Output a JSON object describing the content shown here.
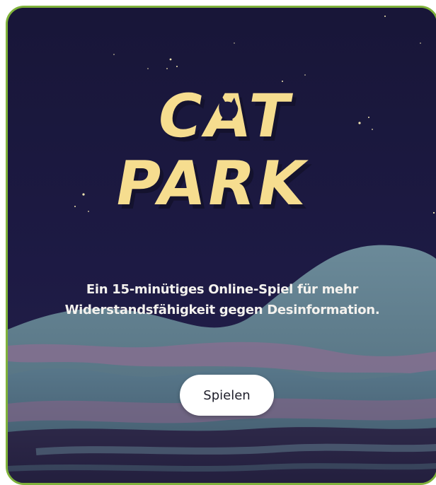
{
  "logo": {
    "line1": "CAT",
    "line2": "PARK",
    "color": "#f6dd8f",
    "shadow_color": "#1a1530"
  },
  "tagline": {
    "line1": "Ein 15-minütiges Online-Spiel für mehr",
    "line2": "Widerstandsfähigkeit gegen Desinformation."
  },
  "play_button": {
    "label": "Spielen"
  },
  "colors": {
    "frame_border": "#7fb23a",
    "sky": "#1b1840",
    "mountain": "#5e7b8c",
    "mountain_dark": "#3e5868",
    "haze_pink": "#8c6b8c",
    "ground": "#2a2545"
  }
}
